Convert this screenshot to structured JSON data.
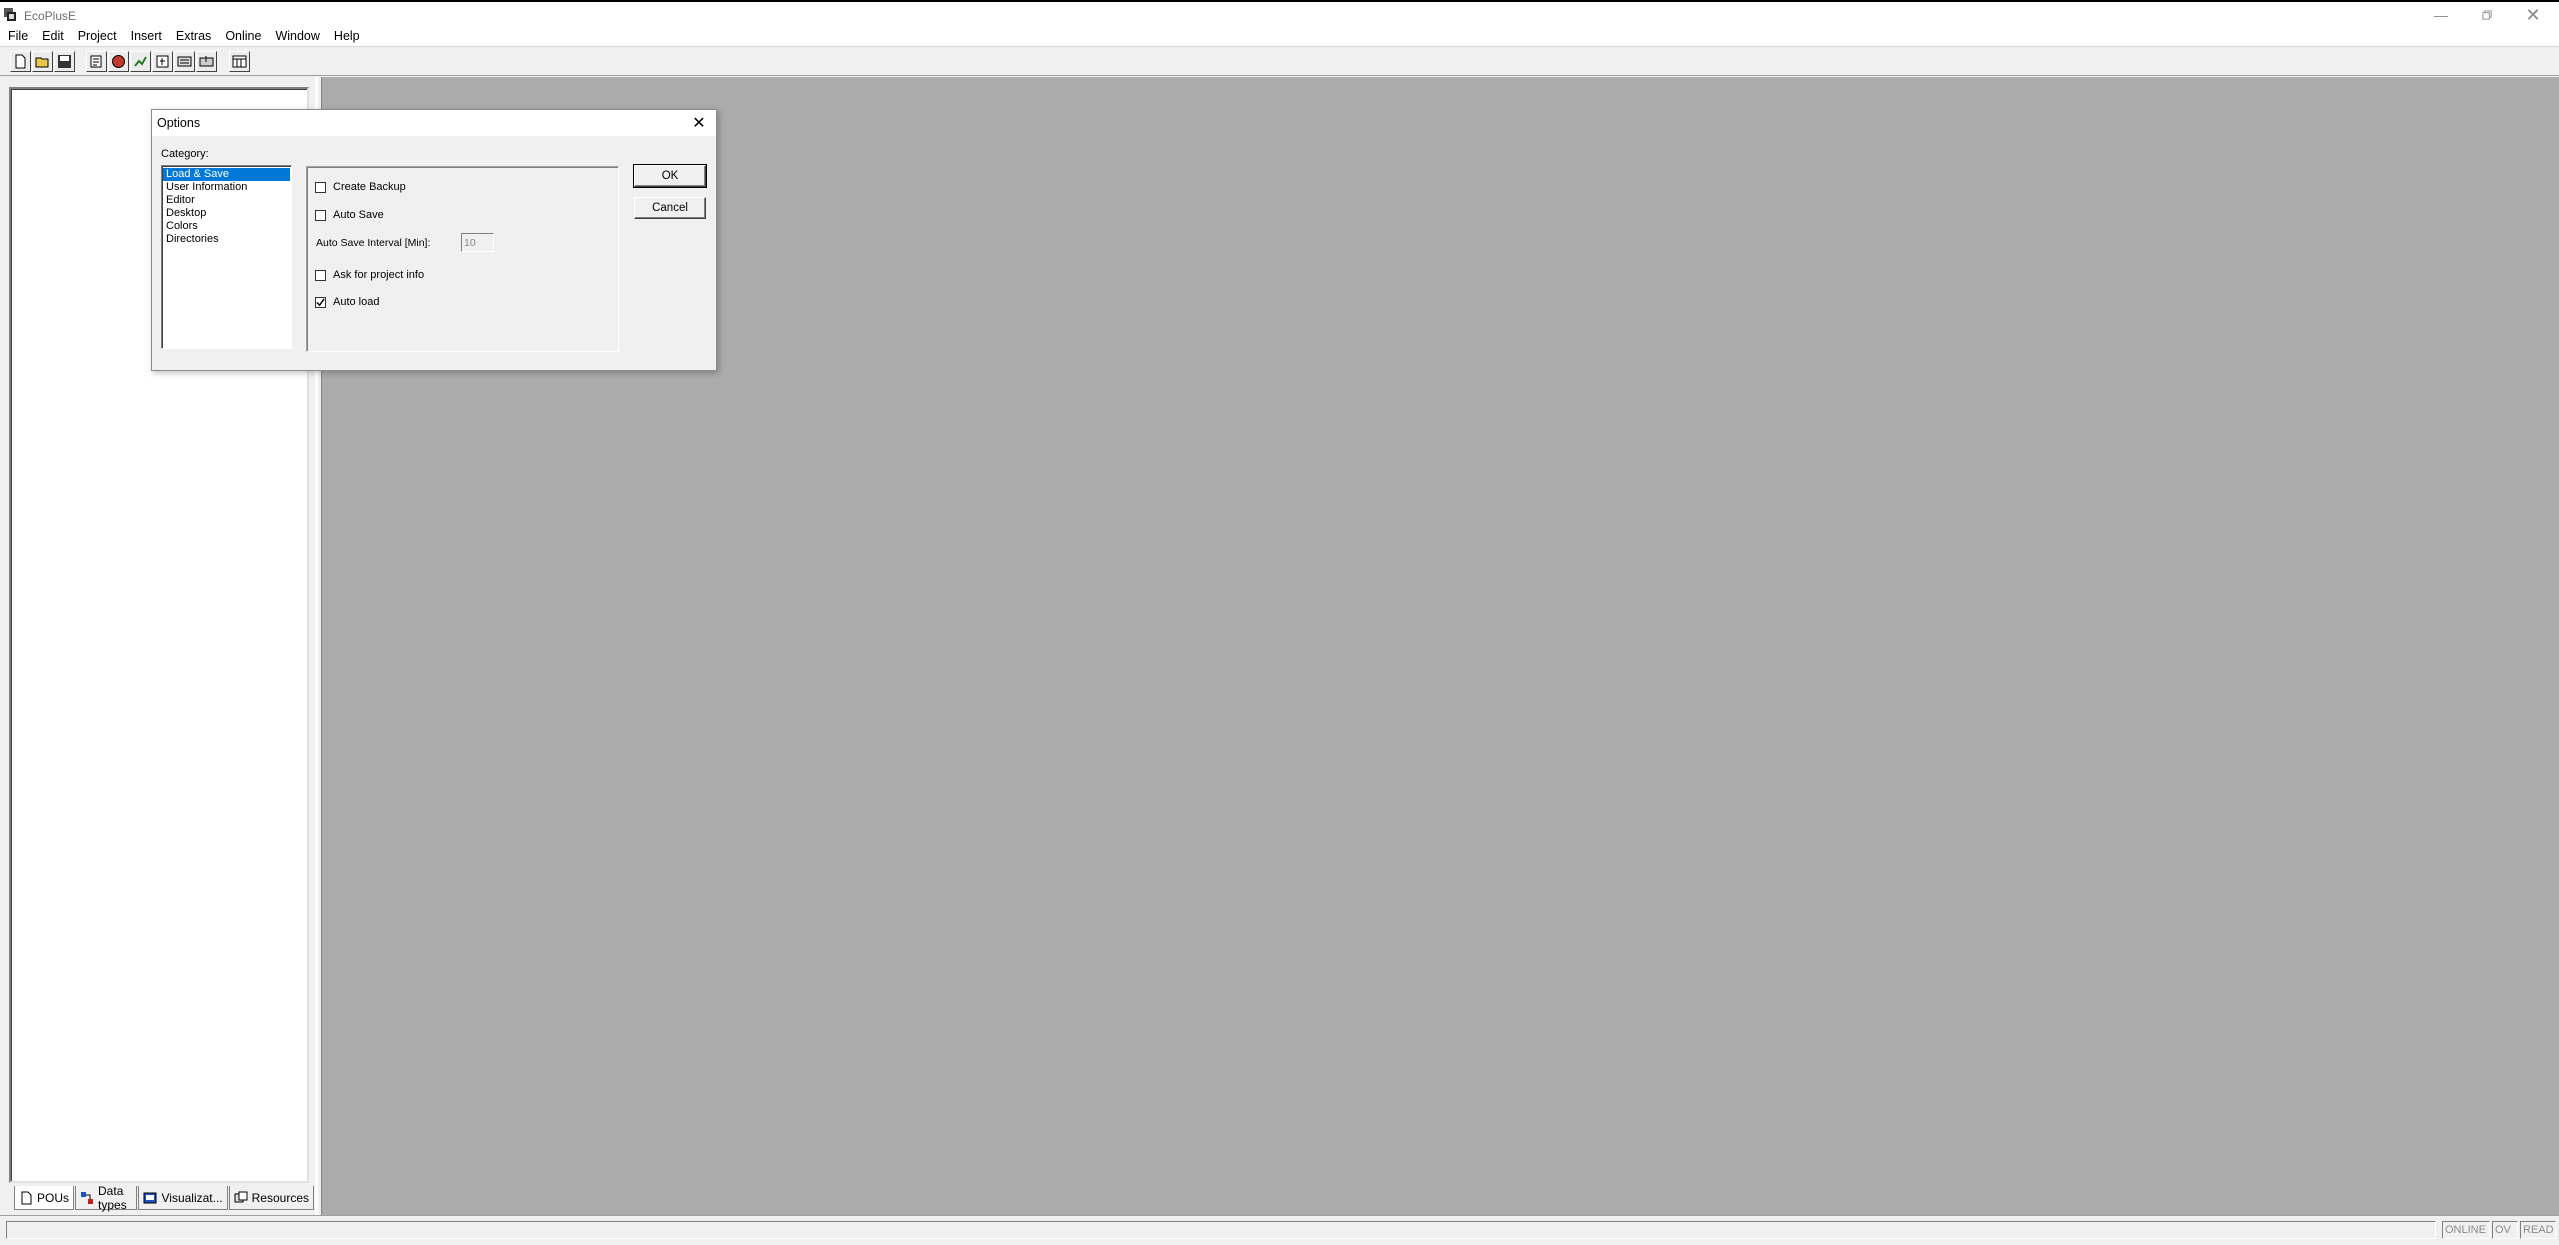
{
  "window": {
    "title": "EcoPlusE"
  },
  "menu": [
    "File",
    "Edit",
    "Project",
    "Insert",
    "Extras",
    "Online",
    "Window",
    "Help"
  ],
  "toolbar": {
    "buttons": [
      "new-file-icon",
      "open-file-icon",
      "save-icon",
      "login-icon",
      "stop-icon",
      "run-icon",
      "step-icon",
      "download-icon",
      "upload-icon",
      "watch-icon"
    ]
  },
  "left_tabs": [
    {
      "label": "POUs",
      "icon": "pou-icon"
    },
    {
      "label": "Data types",
      "icon": "data-types-icon"
    },
    {
      "label": "Visualizat...",
      "icon": "visualization-icon"
    },
    {
      "label": "Resources",
      "icon": "resources-icon"
    }
  ],
  "status": {
    "online": "ONLINE",
    "ov": "OV",
    "read": "READ"
  },
  "dialog": {
    "title": "Options",
    "category_label": "Category:",
    "categories": [
      "Load & Save",
      "User Information",
      "Editor",
      "Desktop",
      "Colors",
      "Directories"
    ],
    "selected_category": "Load & Save",
    "create_backup": {
      "label": "Create Backup",
      "checked": false
    },
    "auto_save": {
      "label": "Auto Save",
      "checked": false
    },
    "interval_label": "Auto Save Interval [Min]:",
    "interval_value": "10",
    "ask_project_info": {
      "label": "Ask for project info",
      "checked": false
    },
    "auto_load": {
      "label": "Auto load",
      "checked": true
    },
    "ok_label": "OK",
    "cancel_label": "Cancel"
  },
  "colors": {
    "mdi_background": "#ababab",
    "selection": "#0078d7"
  }
}
